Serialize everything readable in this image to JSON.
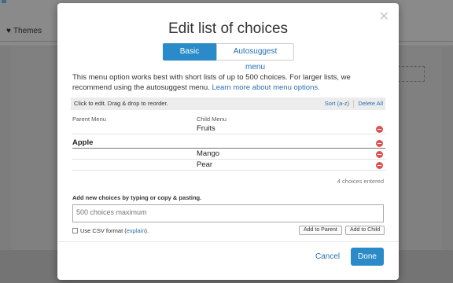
{
  "background": {
    "tab_label": "Themes",
    "tab_icon": "heart-icon"
  },
  "modal": {
    "title": "Edit list of choices",
    "close_icon": "close-icon",
    "tabs": [
      {
        "label": "Basic menu",
        "active": true
      },
      {
        "label": "Autosuggest menu",
        "active": false
      }
    ],
    "description": "This menu option works best with short lists of up to 500 choices. For larger lists, we recommend using the autosuggest menu.",
    "description_link": "Learn more about menu options.",
    "toolbar": {
      "hint": "Click to edit. Drag & drop to reorder.",
      "sort_label": "Sort (a-z)",
      "delete_all_label": "Delete All"
    },
    "columns": {
      "parent": "Parent Menu",
      "child": "Child Menu"
    },
    "rows": [
      {
        "parent": "",
        "child": "Fruits"
      },
      {
        "parent": "Apple",
        "child": ""
      },
      {
        "parent": "",
        "child": "Mango"
      },
      {
        "parent": "",
        "child": "Pear"
      }
    ],
    "count_label": "4 choices entered",
    "add_label": "Add new choices by typing or copy & pasting.",
    "textarea_placeholder": "500 choices maximum",
    "csv_label": "Use CSV format (",
    "csv_link": "explain",
    "csv_suffix": ").",
    "add_parent_label": "Add to Parent",
    "add_child_label": "Add to Child",
    "cancel_label": "Cancel",
    "done_label": "Done"
  },
  "colors": {
    "accent": "#2a8bc8",
    "link": "#2a6fb0",
    "remove": "#e0504f"
  }
}
